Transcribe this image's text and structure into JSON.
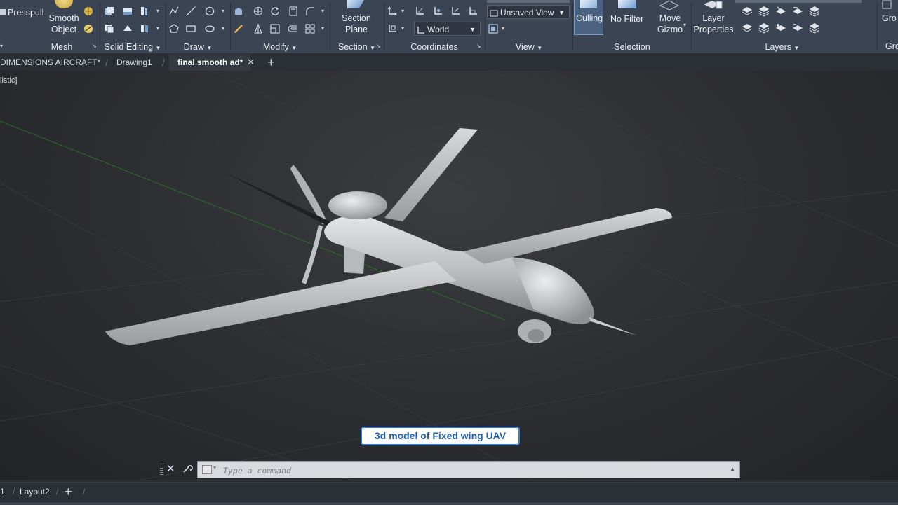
{
  "ribbon": {
    "modeling": {
      "presspull_label": "Presspull",
      "smooth_object_label": "Smooth\nObject",
      "panel_title": "Mesh"
    },
    "solid_editing": {
      "panel_title": "Solid Editing"
    },
    "draw": {
      "panel_title": "Draw"
    },
    "modify": {
      "panel_title": "Modify"
    },
    "section": {
      "section_plane_label": "Section\nPlane",
      "panel_title": "Section"
    },
    "coordinates": {
      "ucs_value": "World",
      "panel_title": "Coordinates"
    },
    "view": {
      "view_value": "Unsaved View",
      "panel_title": "View"
    },
    "selection": {
      "culling_label": "Culling",
      "no_filter_label": "No Filter",
      "move_gizmo_label": "Move\nGizmo",
      "panel_title": "Selection"
    },
    "layers": {
      "layer_properties_label": "Layer\nProperties",
      "panel_title": "Layers"
    },
    "groups": {
      "label": "Gro"
    }
  },
  "tabs": [
    {
      "label": "DIMENSIONS AIRCRAFT*",
      "active": false
    },
    {
      "label": "Drawing1",
      "active": false
    },
    {
      "label": "final smooth ad*",
      "active": true
    }
  ],
  "viewport": {
    "visual_style_label": "listic]",
    "caption": "3d model of Fixed wing UAV"
  },
  "command_line": {
    "placeholder": "Type a command"
  },
  "status_bar": {
    "layout_prefix": "1",
    "layout2_label": "Layout2"
  },
  "colors": {
    "ribbon_bg": "#3b4453",
    "viewport_bg": "#2c2d30",
    "caption_text": "#1f5fb0",
    "caption_border": "#3a7bd5"
  }
}
